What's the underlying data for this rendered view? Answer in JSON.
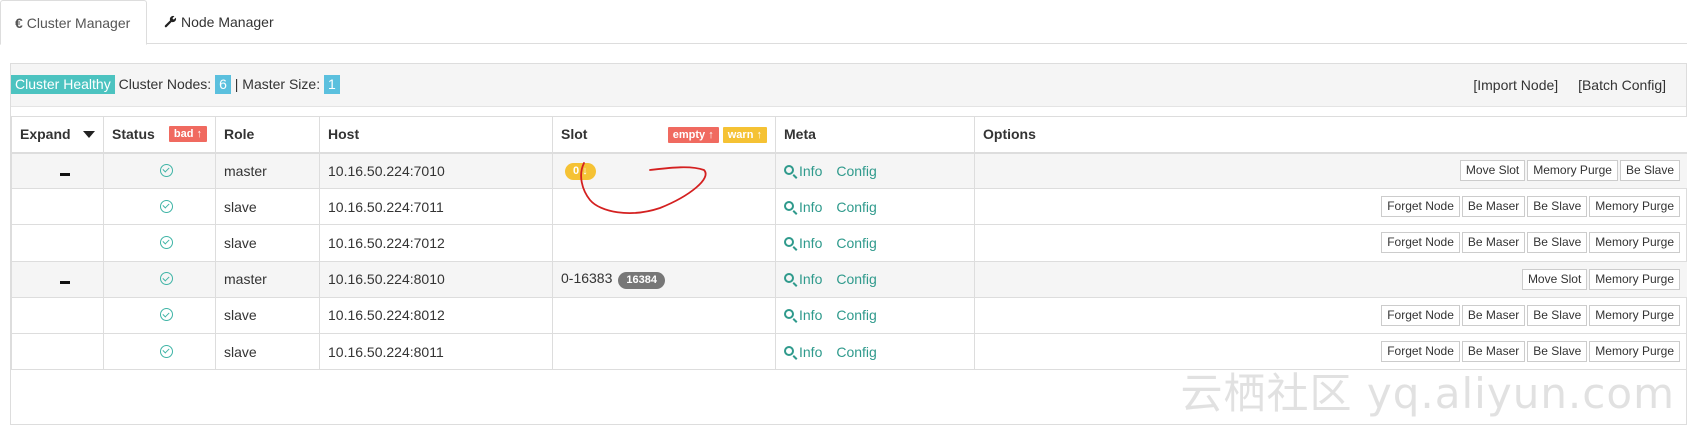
{
  "tabs": [
    {
      "label": "Cluster Manager",
      "icon": "euro-sign-icon"
    },
    {
      "label": "Node Manager",
      "icon": "wrench-icon"
    }
  ],
  "summary": {
    "health_label": "Cluster Healthy",
    "nodes_text": "Cluster Nodes:",
    "nodes_count": "6",
    "master_text": "| Master Size:",
    "master_count": "1",
    "import_node": "[Import Node]",
    "batch_config": "[Batch Config]"
  },
  "table": {
    "headers": {
      "expand": "Expand",
      "status": "Status",
      "status_tag": "bad",
      "role": "Role",
      "host": "Host",
      "slot": "Slot",
      "slot_tag_empty": "empty",
      "slot_tag_warn": "warn",
      "meta": "Meta",
      "options": "Options"
    },
    "rows": [
      {
        "role": "master",
        "host": "10.16.50.224:7010",
        "slot": "",
        "slot_badge": "0",
        "info": "Info",
        "config": "Config",
        "buttons": [
          "Move Slot",
          "Memory Purge",
          "Be Slave"
        ]
      },
      {
        "role": "slave",
        "host": "10.16.50.224:7011",
        "info": "Info",
        "config": "Config",
        "buttons": [
          "Forget Node",
          "Be Maser",
          "Be Slave",
          "Memory Purge"
        ]
      },
      {
        "role": "slave",
        "host": "10.16.50.224:7012",
        "info": "Info",
        "config": "Config",
        "buttons": [
          "Forget Node",
          "Be Maser",
          "Be Slave",
          "Memory Purge"
        ]
      },
      {
        "role": "master",
        "host": "10.16.50.224:8010",
        "slot": "0-16383",
        "slot_badge": "16384",
        "info": "Info",
        "config": "Config",
        "buttons": [
          "Move Slot",
          "Memory Purge"
        ]
      },
      {
        "role": "slave",
        "host": "10.16.50.224:8012",
        "info": "Info",
        "config": "Config",
        "buttons": [
          "Forget Node",
          "Be Maser",
          "Be Slave",
          "Memory Purge"
        ]
      },
      {
        "role": "slave",
        "host": "10.16.50.224:8011",
        "info": "Info",
        "config": "Config",
        "buttons": [
          "Forget Node",
          "Be Maser",
          "Be Slave",
          "Memory Purge"
        ]
      }
    ]
  },
  "watermark": "云栖社区 yq.aliyun.com",
  "colors": {
    "success": "#4cc3c0",
    "info": "#5bc0de",
    "danger": "#f06a60",
    "warning": "#f5c234",
    "link": "#2f9a8c",
    "annotation": "#d42020"
  }
}
